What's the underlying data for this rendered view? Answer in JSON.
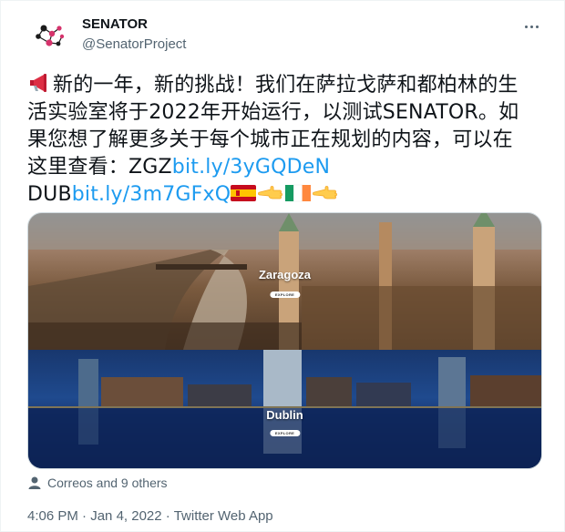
{
  "author": {
    "display_name": "SENATOR",
    "handle": "@SenatorProject",
    "avatar_icon": "senator-logo-icon"
  },
  "menu": {
    "more_icon": "more-horizontal-icon"
  },
  "tweet": {
    "line1_rest": "新的一年，新的挑战！我们在萨拉戈萨和都柏林的生",
    "line2": "活实验室将于2022年开始运行，以测试SENATOR。如",
    "line3": "果您想了解更多关于每个城市正在规划的内容，可以在",
    "line4_prefix": "这里查看：ZGZ",
    "link1": "bit.ly/3yGQDeN",
    "line5_prefix": "DUB",
    "link2": "bit.ly/3m7GFxQ",
    "emojis": [
      "megaphone-icon",
      "spain-flag-icon",
      "pointing-left-icon",
      "ireland-flag-icon",
      "pointing-left-icon"
    ]
  },
  "media": {
    "panels": [
      {
        "city": "Zaragoza",
        "button": "EXPLORE"
      },
      {
        "city": "Dublin",
        "button": "EXPLORE"
      }
    ]
  },
  "likers": {
    "text": "Correos and 9 others",
    "icon": "person-icon"
  },
  "meta": {
    "time": "4:06 PM",
    "separator": " · ",
    "date": "Jan 4, 2022",
    "source": "Twitter Web App"
  },
  "colors": {
    "link": "#1d9bf0",
    "secondary": "#536471",
    "logo_pink": "#d6336c",
    "logo_dark": "#1b1b1b"
  }
}
